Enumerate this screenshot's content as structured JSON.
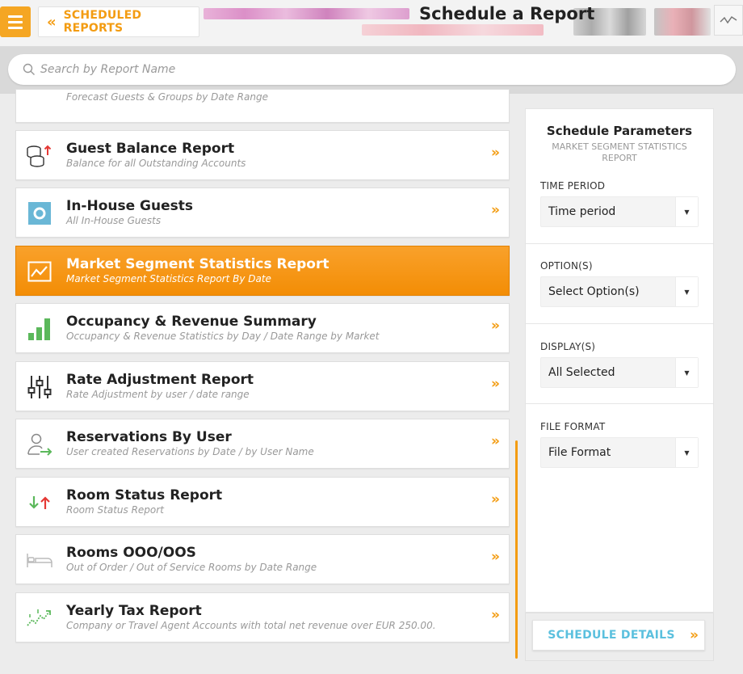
{
  "header": {
    "back_label": "SCHEDULED REPORTS",
    "back_chevron": "«",
    "title": "Schedule a Report"
  },
  "search": {
    "placeholder": "Search by Report Name"
  },
  "reports": [
    {
      "title": "",
      "subtitle": "Forecast Guests & Groups by Date Range",
      "icon": "partial"
    },
    {
      "title": "Guest Balance Report",
      "subtitle": "Balance for all Outstanding Accounts",
      "icon": "coins-icon"
    },
    {
      "title": "In-House Guests",
      "subtitle": "All In-House Guests",
      "icon": "in-house-icon"
    },
    {
      "title": "Market Segment Statistics Report",
      "subtitle": "Market Segment Statistics Report By Date",
      "icon": "line-chart-icon",
      "active": true
    },
    {
      "title": "Occupancy & Revenue Summary",
      "subtitle": "Occupancy & Revenue Statistics by Day / Date Range by Market",
      "icon": "bar-chart-icon"
    },
    {
      "title": "Rate Adjustment Report",
      "subtitle": "Rate Adjustment by user / date range",
      "icon": "sliders-icon"
    },
    {
      "title": "Reservations By User",
      "subtitle": "User created Reservations by Date / by User Name",
      "icon": "user-arrow-icon"
    },
    {
      "title": "Room Status Report",
      "subtitle": "Room Status Report",
      "icon": "up-down-arrows-icon"
    },
    {
      "title": "Rooms OOO/OOS",
      "subtitle": "Out of Order / Out of Service Rooms by Date Range",
      "icon": "bed-icon"
    },
    {
      "title": "Yearly Tax Report",
      "subtitle": "Company or Travel Agent Accounts with total net revenue over EUR 250.00.",
      "icon": "trend-icon"
    }
  ],
  "chevron": "»",
  "panel": {
    "title": "Schedule Parameters",
    "subtitle": "MARKET SEGMENT STATISTICS REPORT",
    "params": [
      {
        "label": "TIME PERIOD",
        "value": "Time period"
      },
      {
        "label": "OPTION(S)",
        "value": "Select Option(s)"
      },
      {
        "label": "DISPLAY(S)",
        "value": "All Selected"
      },
      {
        "label": "FILE FORMAT",
        "value": "File Format"
      }
    ],
    "details_label": "SCHEDULE DETAILS",
    "details_chevron": "»"
  },
  "colors": {
    "accent": "#f39c12",
    "details_text": "#5bc0de",
    "active_card": "#f7961a"
  }
}
